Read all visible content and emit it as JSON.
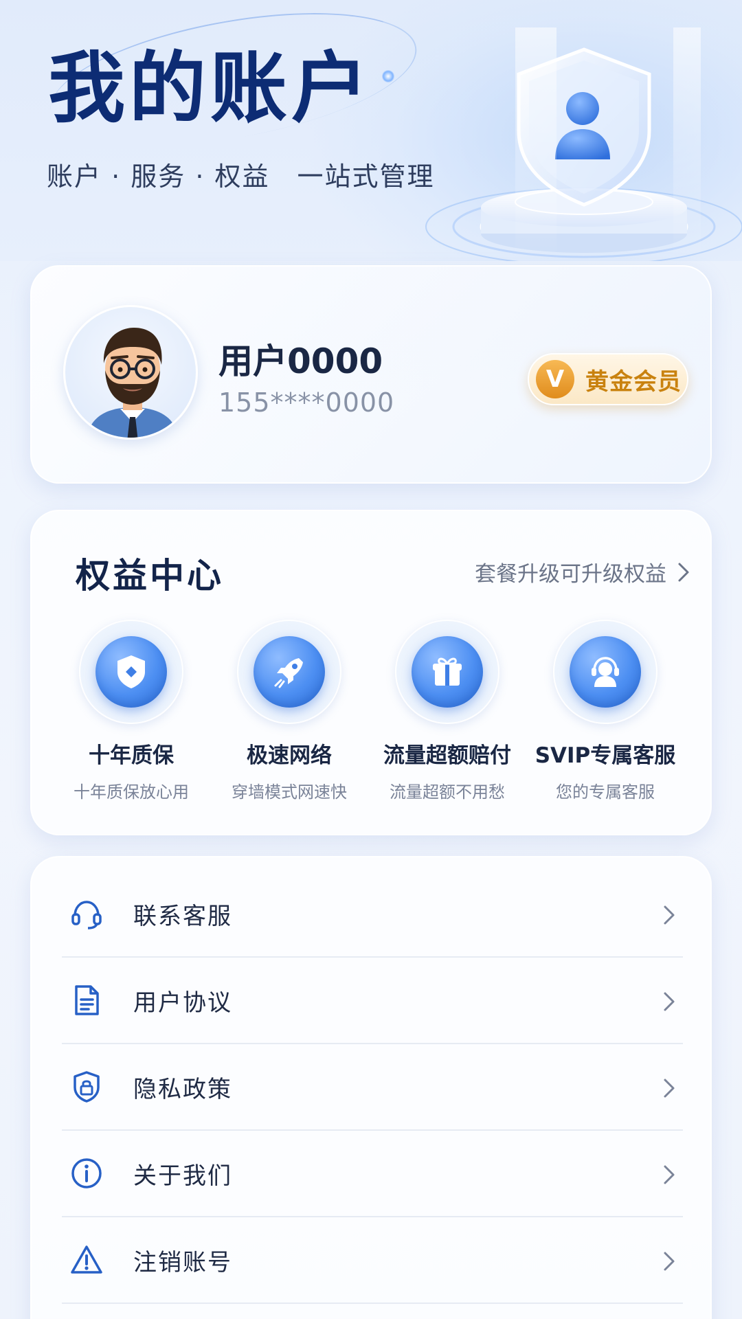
{
  "header": {
    "title": "我的账户",
    "subtitle": "账户 · 服务 · 权益　一站式管理"
  },
  "profile": {
    "name": "用户0000",
    "phone": "155****0000",
    "badge": {
      "letter": "V",
      "label": "黄金会员"
    }
  },
  "benefits": {
    "title": "权益中心",
    "more_label": "套餐升级可升级权益",
    "items": [
      {
        "icon": "shield-icon",
        "title": "十年质保",
        "desc": "十年质保放心用"
      },
      {
        "icon": "rocket-icon",
        "title": "极速网络",
        "desc": "穿墙模式网速快"
      },
      {
        "icon": "gift-icon",
        "title": "流量超额赔付",
        "desc": "流量超额不用愁"
      },
      {
        "icon": "headset-agent-icon",
        "title": "SVIP专属客服",
        "desc": "您的专属客服"
      }
    ]
  },
  "menu": {
    "items": [
      {
        "icon": "headset-icon",
        "label": "联系客服"
      },
      {
        "icon": "document-icon",
        "label": "用户协议"
      },
      {
        "icon": "lock-shield-icon",
        "label": "隐私政策"
      },
      {
        "icon": "info-icon",
        "label": "关于我们"
      },
      {
        "icon": "warning-icon",
        "label": "注销账号"
      }
    ]
  },
  "colors": {
    "primary": "#0d2c74",
    "accent_blue": "#4d8ff2",
    "gold": "#c9820f",
    "background": "#edf3fd"
  }
}
